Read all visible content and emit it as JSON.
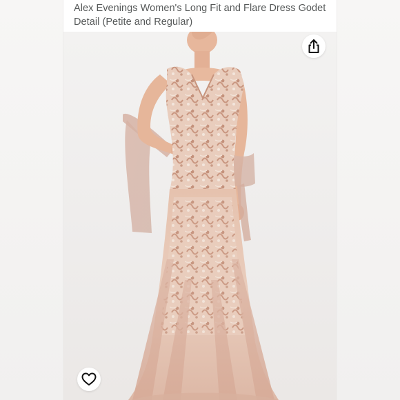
{
  "product": {
    "title": "Alex Evenings Women's Long Fit and Flare Dress Godet Detail (Petite and Regular)",
    "image_alt": "Model wearing a blush lace long fit and flare gown with a sheer shawl"
  },
  "actions": {
    "share_icon": "share-icon",
    "wishlist_icon": "heart-outline-icon"
  },
  "colors": {
    "dress_base": "#e7c9b9",
    "lace": "#c99b86",
    "lace_light": "#f1e2d6",
    "tulle": "#dcb8a8",
    "skin": "#e8b99e",
    "background": "#f1efee",
    "text": "#565959"
  }
}
